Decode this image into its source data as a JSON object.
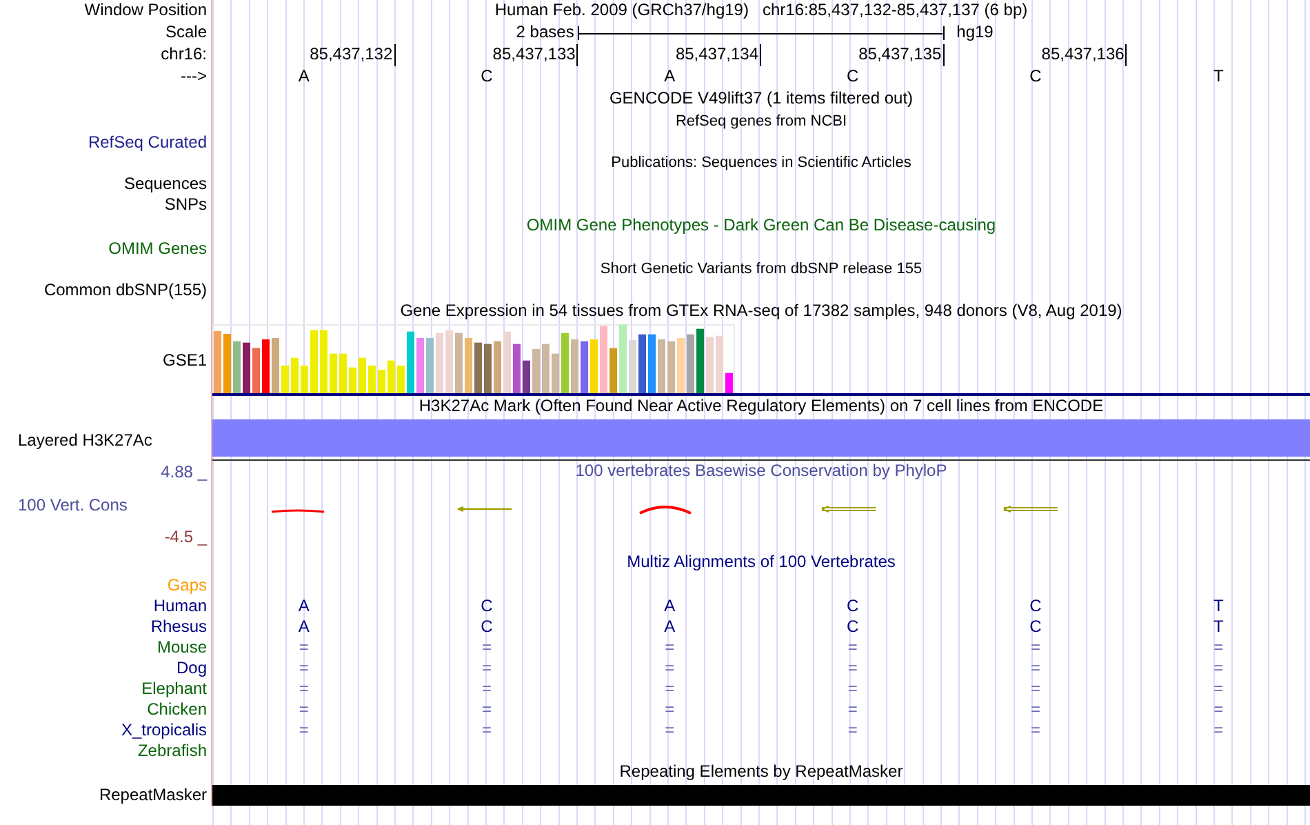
{
  "header": {
    "position_label": "Window Position",
    "assembly": "Human Feb. 2009 (GRCh37/hg19)",
    "position": "chr16:85,437,132-85,437,137 (6 bp)",
    "scale_label": "Scale",
    "scale_text": "2 bases",
    "scale_assembly": "hg19",
    "ruler_label": "chr16:",
    "ruler_ticks": [
      "85,437,132",
      "85,437,133",
      "85,437,134",
      "85,437,135",
      "85,437,136"
    ],
    "strand_label": "--->",
    "bases": [
      "A",
      "C",
      "A",
      "C",
      "C",
      "T"
    ]
  },
  "tracks": [
    {
      "kind": "title",
      "text": "GENCODE V49lift37 (1 items filtered out)",
      "color": "#000000"
    },
    {
      "kind": "subtitle",
      "text": "RefSeq genes from NCBI"
    },
    {
      "kind": "label",
      "label": "RefSeq Curated",
      "color": "#1f1f8c"
    },
    {
      "kind": "subtitle",
      "text": "Publications: Sequences in Scientific Articles"
    },
    {
      "kind": "label",
      "label": "Sequences",
      "color": "#000000"
    },
    {
      "kind": "label",
      "label": "SNPs",
      "color": "#000000"
    },
    {
      "kind": "title",
      "text": "OMIM Gene Phenotypes - Dark Green Can Be Disease-causing",
      "color": "#0a640a"
    },
    {
      "kind": "label",
      "label": "OMIM Genes",
      "color": "#0a640a"
    },
    {
      "kind": "subtitle",
      "text": "Short Genetic Variants from dbSNP release 155"
    },
    {
      "kind": "label",
      "label": "Common dbSNP(155)",
      "color": "#000000"
    },
    {
      "kind": "title",
      "text": "Gene Expression in 54 tissues from GTEx RNA-seq of 17382 samples, 948 donors (V8, Aug 2019)",
      "color": "#000000"
    },
    {
      "kind": "expression",
      "label": "GSE1"
    },
    {
      "kind": "title",
      "text": "H3K27Ac Mark (Often Found Near Active Regulatory Elements) on 7 cell lines from ENCODE",
      "color": "#000000"
    },
    {
      "kind": "band",
      "label": "Layered H3K27Ac"
    },
    {
      "kind": "conservation",
      "title": "100 vertebrates Basewise Conservation by PhyloP",
      "label": "100 Vert. Cons",
      "top": "4.88 _",
      "bottom": "-4.5 _"
    },
    {
      "kind": "title",
      "text": "Multiz Alignments of 100 Vertebrates",
      "color": "#000080"
    },
    {
      "kind": "label",
      "label": "Gaps",
      "color": "#ff9900"
    },
    {
      "kind": "align",
      "label": "Human",
      "color": "#000080",
      "cells": [
        "A",
        "C",
        "A",
        "C",
        "C",
        "T"
      ]
    },
    {
      "kind": "align",
      "label": "Rhesus",
      "color": "#000080",
      "cells": [
        "A",
        "C",
        "A",
        "C",
        "C",
        "T"
      ]
    },
    {
      "kind": "match",
      "label": "Mouse",
      "color": "#0a640a",
      "cells": [
        "=",
        "=",
        "=",
        "=",
        "=",
        "="
      ]
    },
    {
      "kind": "match",
      "label": "Dog",
      "color": "#000080",
      "cells": [
        "=",
        "=",
        "=",
        "=",
        "=",
        "="
      ]
    },
    {
      "kind": "match",
      "label": "Elephant",
      "color": "#0a640a",
      "cells": [
        "=",
        "=",
        "=",
        "=",
        "=",
        "="
      ]
    },
    {
      "kind": "match",
      "label": "Chicken",
      "color": "#0a640a",
      "cells": [
        "=",
        "=",
        "=",
        "=",
        "=",
        "="
      ]
    },
    {
      "kind": "match",
      "label": "X_tropicalis",
      "color": "#000080",
      "cells": [
        "=",
        "=",
        "=",
        "=",
        "=",
        "="
      ]
    },
    {
      "kind": "label",
      "label": "Zebrafish",
      "color": "#0a640a"
    },
    {
      "kind": "title",
      "text": "Repeating Elements by RepeatMasker",
      "color": "#000000"
    },
    {
      "kind": "repeat",
      "label": "RepeatMasker"
    }
  ]
}
